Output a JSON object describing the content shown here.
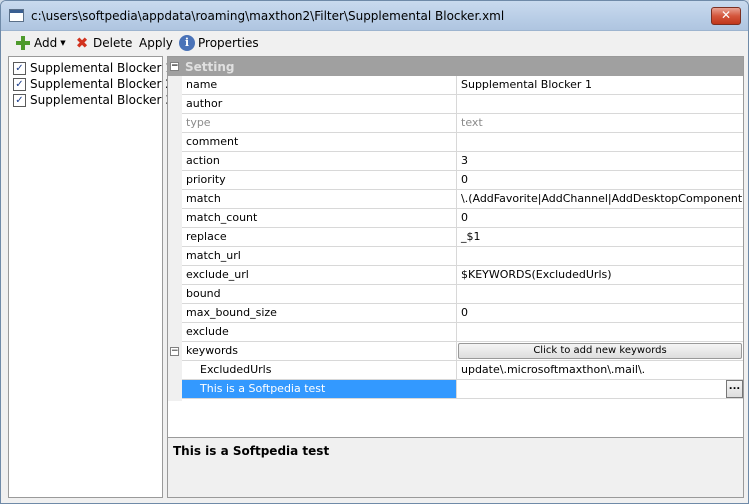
{
  "window": {
    "title": "c:\\users\\softpedia\\appdata\\roaming\\maxthon2\\Filter\\Supplemental Blocker.xml",
    "close_label": "✕"
  },
  "toolbar": {
    "add_label": "Add",
    "delete_label": "Delete",
    "apply_label": "Apply",
    "properties_label": "Properties"
  },
  "filters": [
    {
      "label": "Supplemental Blocker 1",
      "checked": true
    },
    {
      "label": "Supplemental Blocker 2",
      "checked": true
    },
    {
      "label": "Supplemental Blocker 3",
      "checked": true
    }
  ],
  "grid": {
    "section_label": "Setting",
    "rows": [
      {
        "name": "name",
        "value": "Supplemental Blocker 1"
      },
      {
        "name": "author",
        "value": ""
      },
      {
        "name": "type",
        "value": "text"
      },
      {
        "name": "comment",
        "value": ""
      },
      {
        "name": "action",
        "value": "3"
      },
      {
        "name": "priority",
        "value": "0"
      },
      {
        "name": "match",
        "value": "\\.(AddFavorite|AddChannel|AddDesktopComponent|S"
      },
      {
        "name": "match_count",
        "value": "0"
      },
      {
        "name": "replace",
        "value": "_$1"
      },
      {
        "name": "match_url",
        "value": ""
      },
      {
        "name": "exclude_url",
        "value": "$KEYWORDS(ExcludedUrls)"
      },
      {
        "name": "bound",
        "value": ""
      },
      {
        "name": "max_bound_size",
        "value": "0"
      },
      {
        "name": "exclude",
        "value": ""
      }
    ],
    "keywords": {
      "name": "keywords",
      "button_label": "Click to add new keywords",
      "items": [
        {
          "name": "ExcludedUrls",
          "value": "update\\.microsoftmaxthon\\.mail\\."
        },
        {
          "name": "This is a Softpedia test",
          "value": ""
        }
      ]
    },
    "ellipsis_label": "..."
  },
  "description": {
    "text": "This is a Softpedia test"
  }
}
